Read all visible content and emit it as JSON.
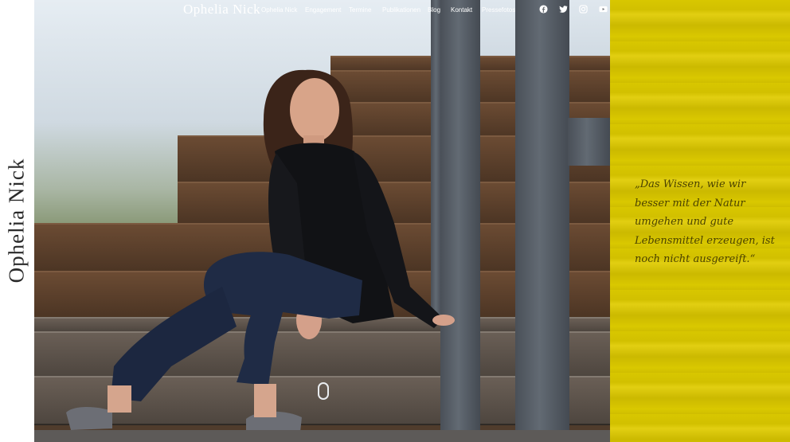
{
  "site": {
    "vertical_title": "Ophelia Nick",
    "brand": "Ophelia Nick"
  },
  "nav": {
    "items": [
      "Ophelia Nick",
      "Engagement",
      "Termine",
      "Publikationen",
      "Blog",
      "Kontakt",
      "Pressefotos"
    ],
    "social_icons": [
      "facebook-icon",
      "twitter-icon",
      "instagram-icon",
      "youtube-icon"
    ]
  },
  "quote": {
    "text": "„Das Wissen, wie wir besser mit der Natur umgehen und gute Lebensmittel erzeugen, ist noch nicht ausgereift.“"
  },
  "colors": {
    "accent_yellow": "#d8c700",
    "quote_text": "#4b4200"
  }
}
